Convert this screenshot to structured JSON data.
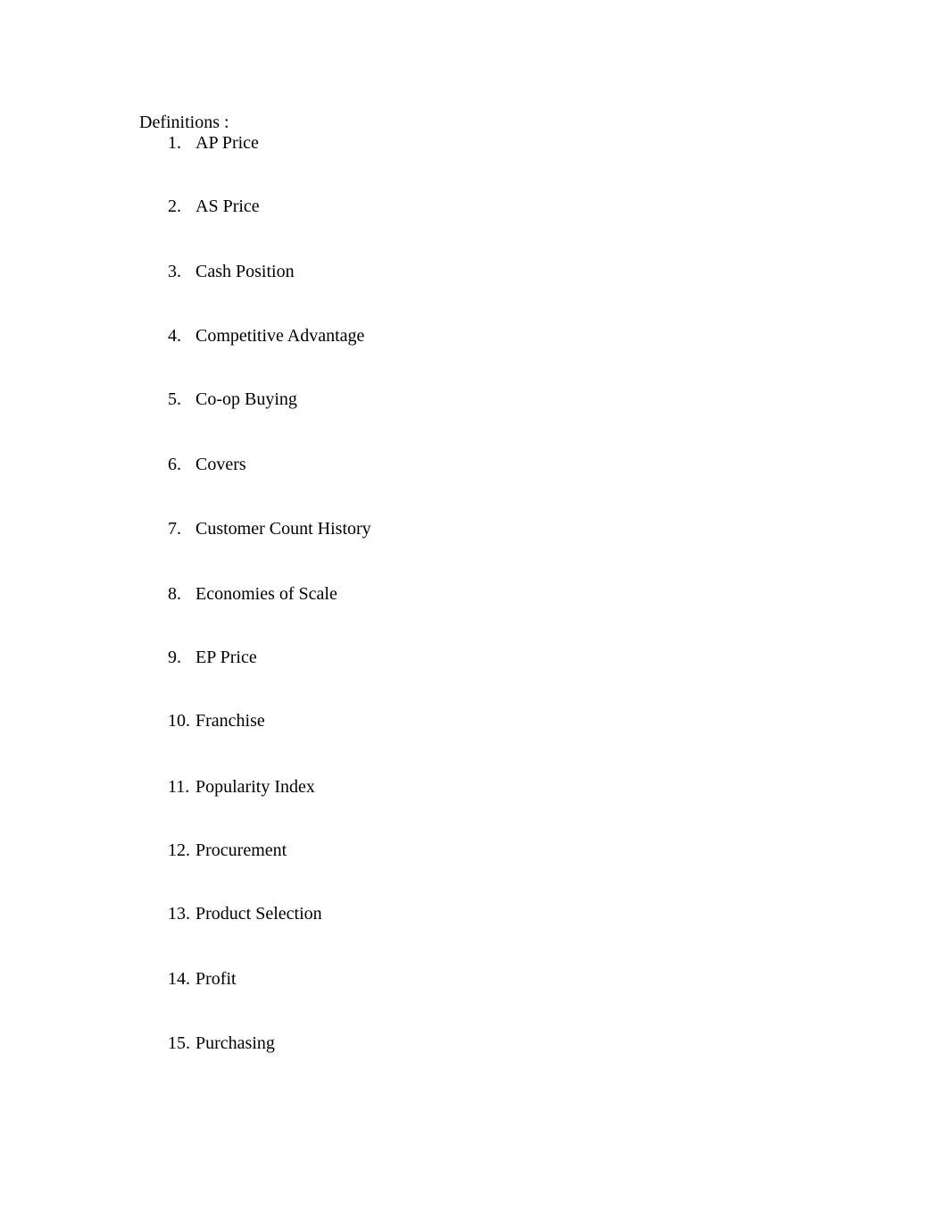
{
  "document": {
    "heading": "Definitions :",
    "items": [
      {
        "number": "1.",
        "term": "AP Price"
      },
      {
        "number": "2.",
        "term": "AS Price"
      },
      {
        "number": "3.",
        "term": "Cash Position"
      },
      {
        "number": "4.",
        "term": "Competitive Advantage"
      },
      {
        "number": "5.",
        "term": "Co-op Buying"
      },
      {
        "number": "6.",
        "term": "Covers"
      },
      {
        "number": "7.",
        "term": "Customer Count History"
      },
      {
        "number": "8.",
        "term": "Economies of Scale"
      },
      {
        "number": "9.",
        "term": "EP Price"
      },
      {
        "number": "10.",
        "term": "Franchise"
      },
      {
        "number": "11.",
        "term": "Popularity Index"
      },
      {
        "number": "12.",
        "term": "Procurement"
      },
      {
        "number": "13.",
        "term": "Product Selection"
      },
      {
        "number": "14.",
        "term": "Profit"
      },
      {
        "number": "15.",
        "term": "Purchasing"
      }
    ]
  }
}
